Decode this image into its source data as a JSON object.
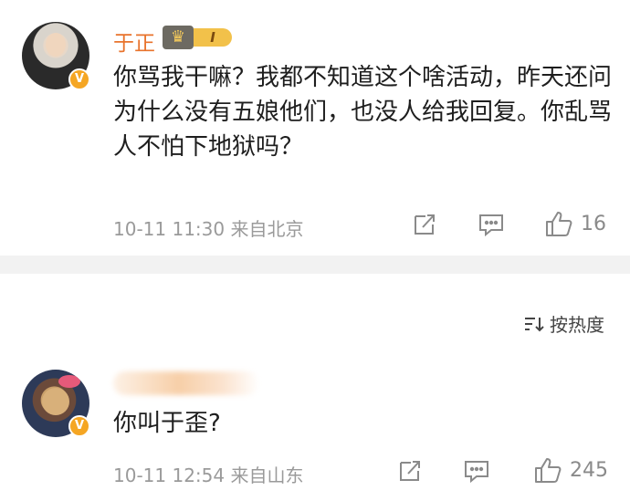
{
  "comments": [
    {
      "username": "于正",
      "level": "I",
      "verified": "V",
      "text": "你骂我干嘛？我都不知道这个啥活动，昨天还问为什么没有五娘他们，也没人给我回复。你乱骂人不怕下地狱吗？",
      "meta": "10-11 11:30 来自北京",
      "likes": "16"
    },
    {
      "username": "",
      "verified": "V",
      "text": "你叫于歪?",
      "meta": "10-11 12:54 来自山东",
      "likes": "245"
    }
  ],
  "sort": {
    "label": "按热度"
  },
  "icons": {
    "share": "share-icon",
    "reply": "comment-icon",
    "like": "thumbs-up-icon",
    "sort": "sort-icon",
    "crown": "crown-icon"
  },
  "colors": {
    "username": "#e8732c",
    "meta": "#9a9a9a",
    "badge": "#f5a623"
  }
}
